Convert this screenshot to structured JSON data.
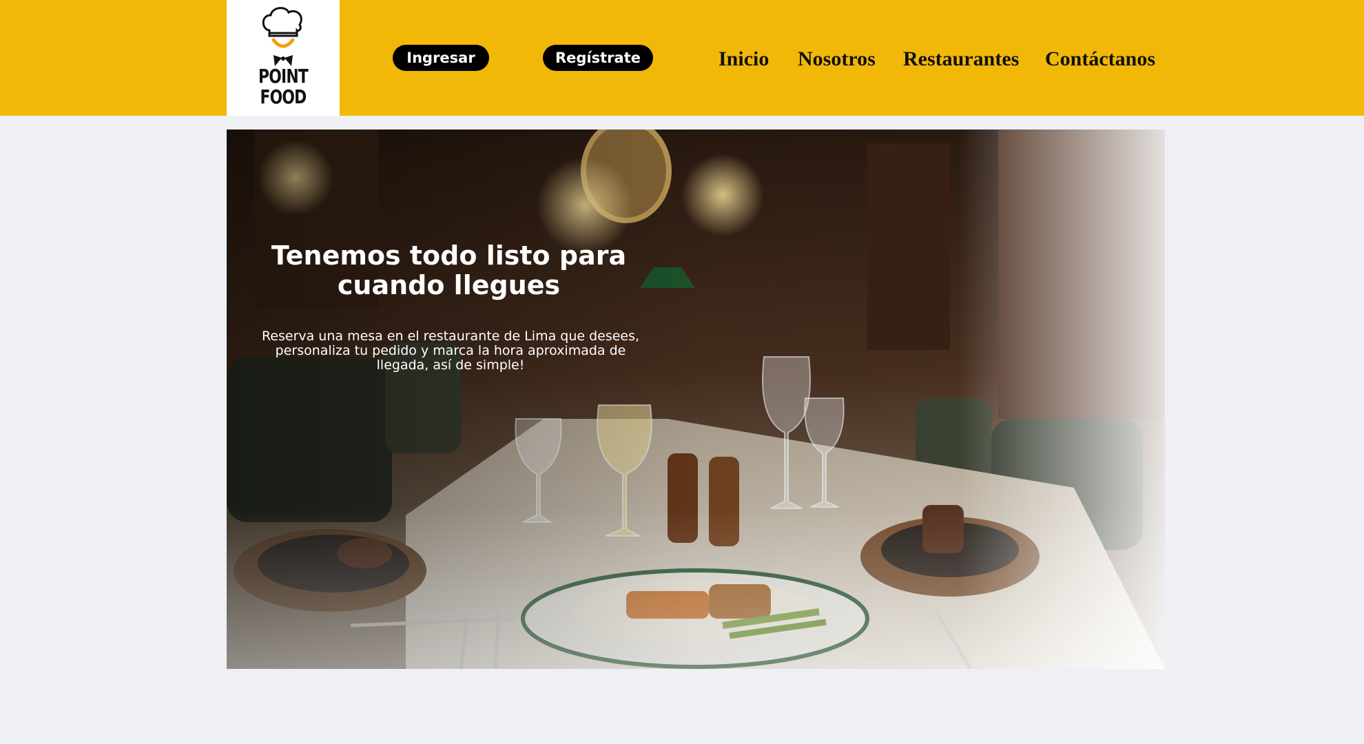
{
  "logo": {
    "line1": "POINT",
    "line2": "FOOD",
    "icon": "chef-hat-logo-icon"
  },
  "auth": {
    "login_label": "Ingresar",
    "register_label": "Regístrate"
  },
  "nav": {
    "items": [
      {
        "label": "Inicio"
      },
      {
        "label": "Nosotros"
      },
      {
        "label": "Restaurantes"
      },
      {
        "label": "Contáctanos"
      }
    ]
  },
  "hero": {
    "title": "Tenemos todo listo para\ncuando llegues",
    "subtitle": "Reserva una mesa en el restaurante de Lima que desees,\npersonaliza tu pedido y marca la hora aproximada de\nllegada, así de simple!",
    "image": "restaurant-dining-table-photo"
  },
  "colors": {
    "brand": "#f2b807",
    "page_bg": "#eef0f5",
    "button_bg": "#000000"
  }
}
